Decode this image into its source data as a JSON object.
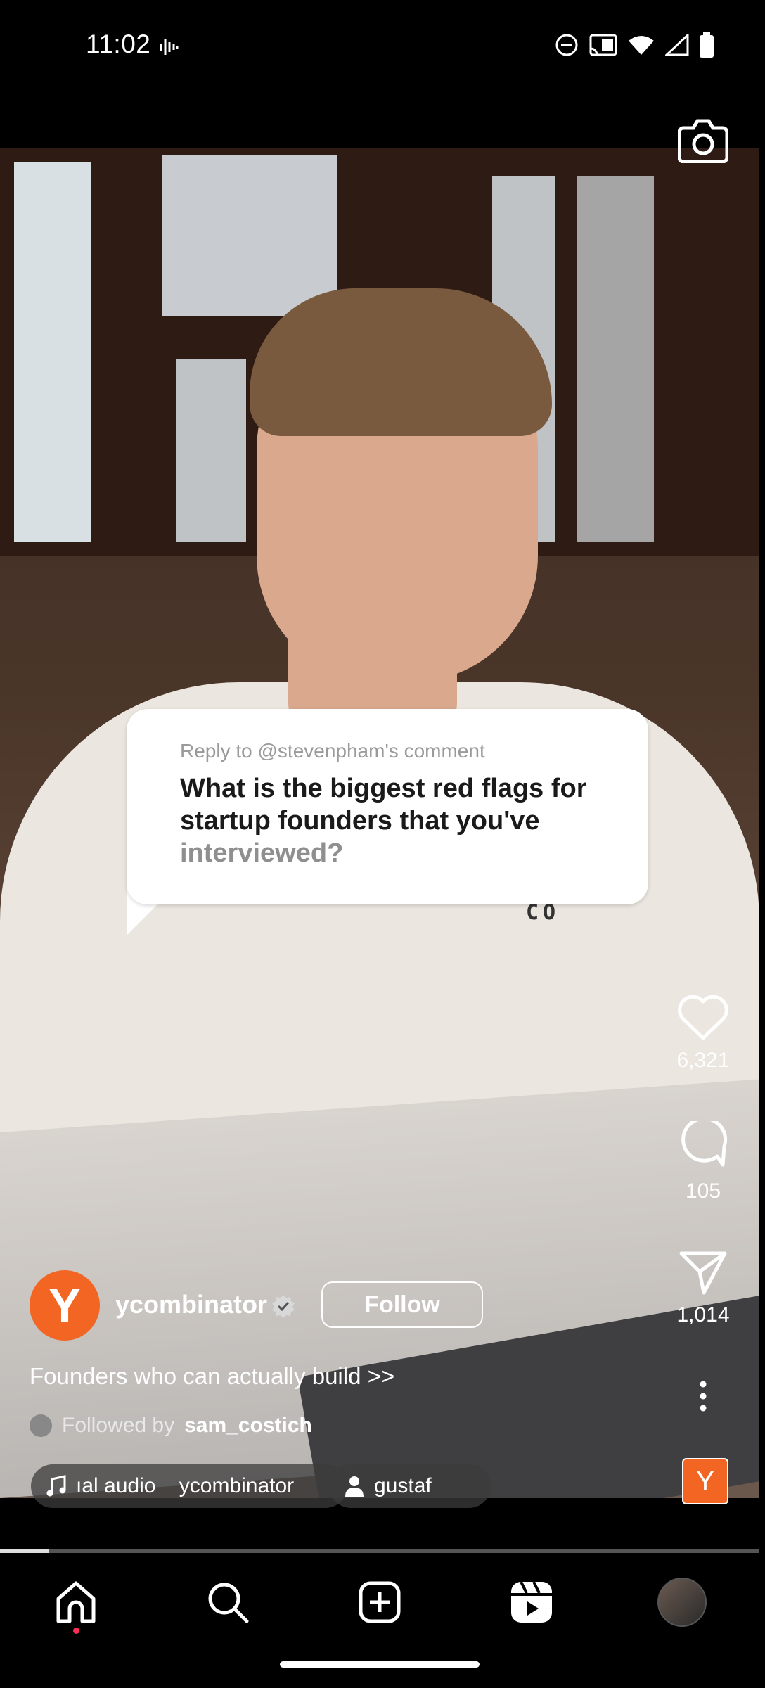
{
  "status_bar": {
    "time": "11:02",
    "icons": [
      "voicemail-icon",
      "dnd-icon",
      "cast-icon",
      "wifi-icon",
      "signal-icon",
      "battery-icon"
    ]
  },
  "video": {
    "comment_bubble": {
      "reply_to": "Reply to @stevenpham's comment",
      "question_main": "What is the biggest red flags for startup founders that you've",
      "question_faded": "interviewed?"
    },
    "shirt_text": "CO"
  },
  "right_rail": {
    "like_count": "6,321",
    "comment_count": "105",
    "share_count": "1,014",
    "audio_avatar_letter": "Y"
  },
  "post": {
    "avatar_letter": "Y",
    "username": "ycombinator",
    "follow_label": "Follow",
    "caption": "Founders who can actually build >>",
    "followed_by_prefix": "Followed by",
    "followed_by_user": "sam_costich",
    "audio_chip": "ıal audio    ycombinator",
    "tag_chip": "gustaf"
  },
  "progress": {
    "fraction": 0.065
  },
  "colors": {
    "brand_orange": "#f26522",
    "background": "#000000"
  }
}
